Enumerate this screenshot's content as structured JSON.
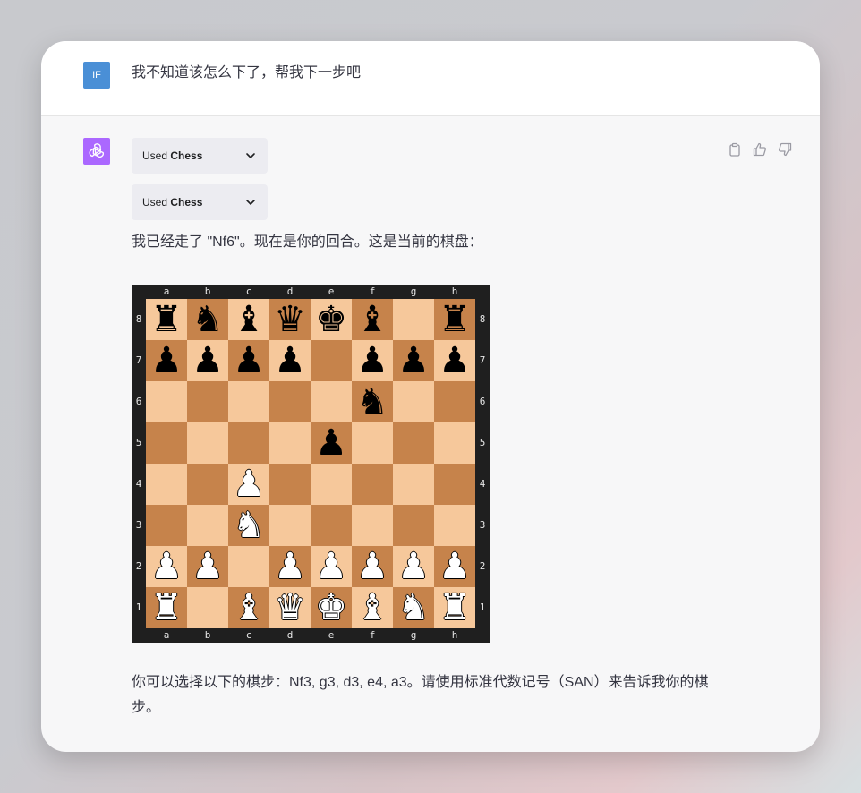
{
  "user": {
    "avatar_initials": "IF",
    "message": "我不知道该怎么下了，帮我下一步吧"
  },
  "assistant": {
    "plugin_calls": [
      {
        "prefix": "Used",
        "name": "Chess"
      },
      {
        "prefix": "Used",
        "name": "Chess"
      }
    ],
    "intro_text": "我已经走了 \"Nf6\"。现在是你的回合。这是当前的棋盘：",
    "closing_text_line1": "你可以选择以下的棋步：Nf3, g3, d3, e4, a3。请使用标准代数记号（SAN）来告诉我你的棋",
    "closing_text_line2": "步。"
  },
  "actions": [
    {
      "name": "copy-icon"
    },
    {
      "name": "thumbs-up-icon"
    },
    {
      "name": "thumbs-down-icon"
    }
  ],
  "chessboard": {
    "files": [
      "a",
      "b",
      "c",
      "d",
      "e",
      "f",
      "g",
      "h"
    ],
    "ranks": [
      "8",
      "7",
      "6",
      "5",
      "4",
      "3",
      "2",
      "1"
    ],
    "rows": [
      [
        "r",
        "n",
        "b",
        "q",
        "k",
        "b",
        "",
        "r"
      ],
      [
        "p",
        "p",
        "p",
        "p",
        "",
        "p",
        "p",
        "p"
      ],
      [
        "",
        "",
        "",
        "",
        "",
        "n",
        "",
        ""
      ],
      [
        "",
        "",
        "",
        "",
        "p",
        "",
        "",
        ""
      ],
      [
        "",
        "",
        "P",
        "",
        "",
        "",
        "",
        ""
      ],
      [
        "",
        "",
        "N",
        "",
        "",
        "",
        "",
        ""
      ],
      [
        "P",
        "P",
        "",
        "P",
        "P",
        "P",
        "P",
        "P"
      ],
      [
        "R",
        "",
        "B",
        "Q",
        "K",
        "B",
        "N",
        "R"
      ]
    ],
    "light_color": "#f6c89b",
    "dark_color": "#c6834b",
    "border_color": "#1f1f1f"
  },
  "colors": {
    "bot_avatar": "#ab68ff",
    "user_avatar": "#4a8fd6",
    "pill_bg": "#ececf1"
  }
}
